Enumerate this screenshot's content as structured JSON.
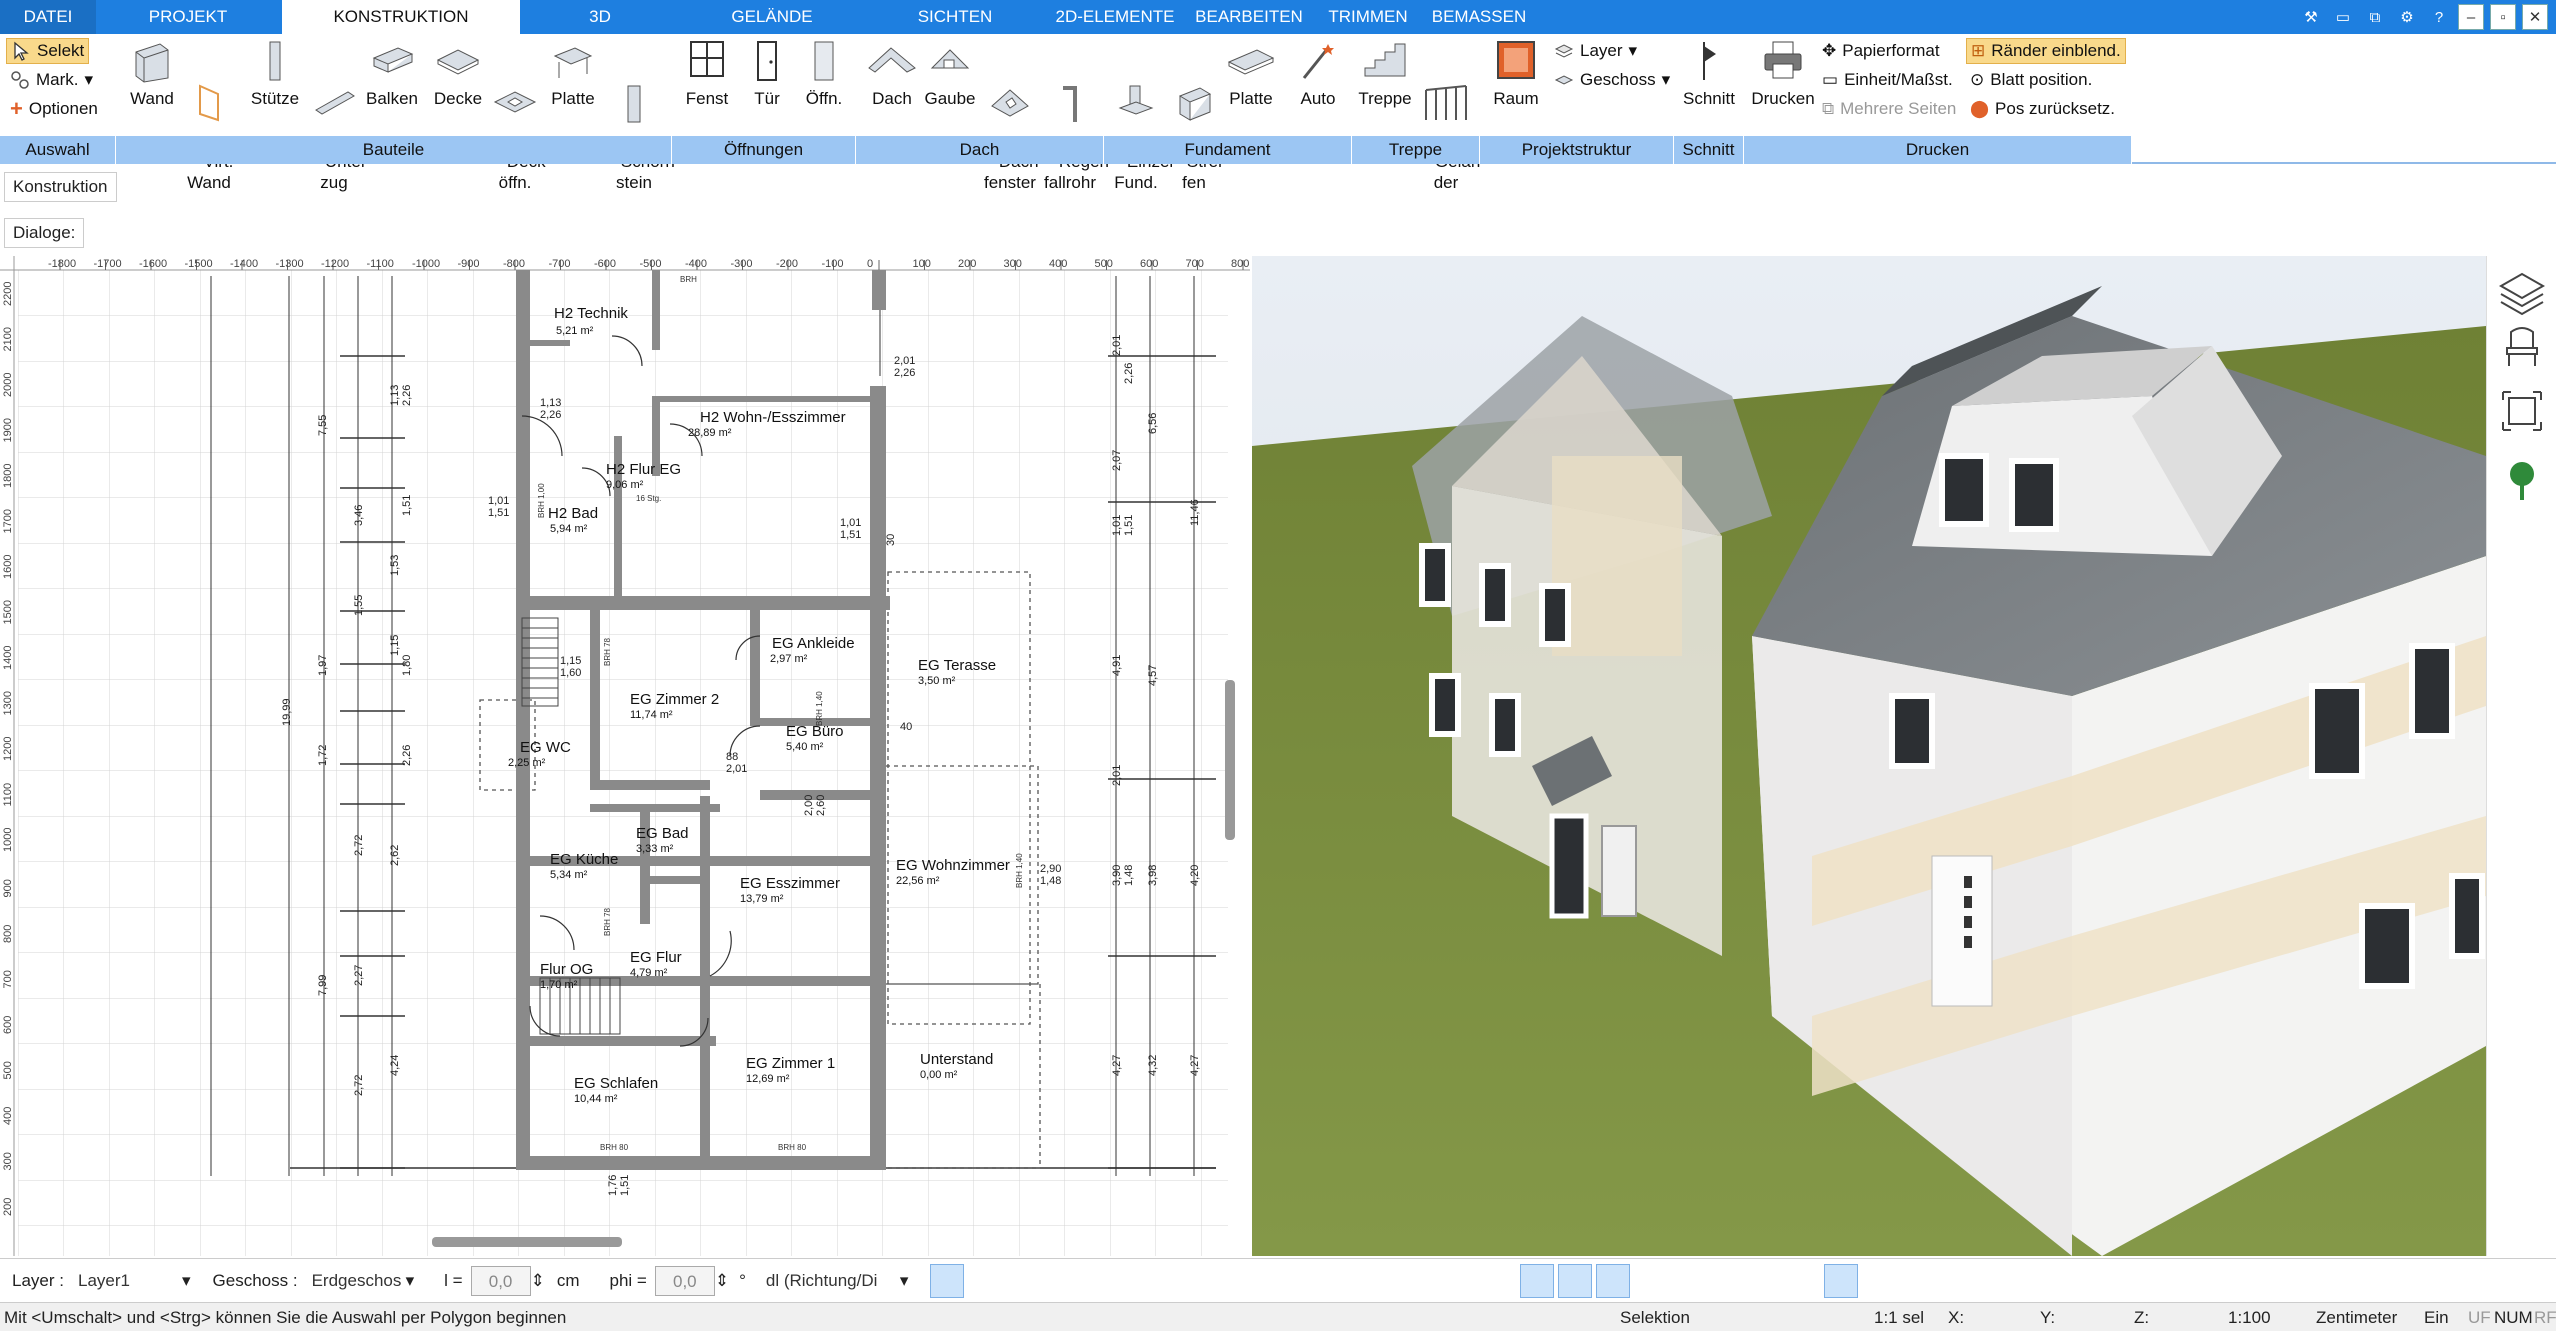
{
  "tabs": [
    "DATEI",
    "PROJEKT",
    "KONSTRUKTION",
    "3D",
    "GELÄNDE",
    "SICHTEN",
    "2D-ELEMENTE",
    "BEARBEITEN",
    "TRIMMEN",
    "BEMASSEN"
  ],
  "active_tab": "KONSTRUKTION",
  "ribbon": {
    "auswahl": {
      "selekt": "Selekt",
      "mark": "Mark.",
      "optionen": "Optionen"
    },
    "buttons": {
      "wand": "Wand",
      "virt_wand": "Virt.\nWand",
      "stuetze": "Stütze",
      "unterzug": "Unter-\nzug",
      "balken": "Balken",
      "decke": "Decke",
      "deckoeffn": "Deck-\nöffn.",
      "platte": "Platte",
      "schornstein": "Schorn-\nstein",
      "fenst": "Fenst",
      "tuer": "Tür",
      "oeffn": "Öffn.",
      "dach": "Dach",
      "gaube": "Gaube",
      "dachfenster": "Dach-\nfenster",
      "regenfallrohr": "Regen-\nfallrohr",
      "einzelfund": "Einzel\nFund.",
      "streifen": "Strei-\nfen",
      "fplatte": "Platte",
      "auto": "Auto",
      "treppe": "Treppe",
      "gelaender": "Gelän-\nder",
      "raum": "Raum",
      "schnitt": "Schnitt",
      "drucken": "Drucken"
    },
    "projektstruktur": {
      "layer": "Layer",
      "geschoss": "Geschoss"
    },
    "druck": {
      "papierformat": "Papierformat",
      "einheit": "Einheit/Maßst.",
      "mehrere": "Mehrere Seiten",
      "raender": "Ränder einblend.",
      "blatt": "Blatt position.",
      "pos": "Pos zurücksetz."
    },
    "groups": [
      "Auswahl",
      "Bauteile",
      "Öffnungen",
      "Dach",
      "Fundament",
      "Treppe",
      "Projektstruktur",
      "Schnitt",
      "Drucken"
    ]
  },
  "panel": {
    "konstruktion": "Konstruktion",
    "dialoge": "Dialoge:"
  },
  "ruler_top": [
    "-1800",
    "-1700",
    "-1600",
    "-1500",
    "-1400",
    "-1300",
    "-1200",
    "-1100",
    "-1000",
    "-900",
    "-800",
    "-700",
    "-600",
    "-500",
    "-400",
    "-300",
    "-200",
    "-100",
    "0",
    "100",
    "200",
    "300",
    "400",
    "500",
    "600",
    "700",
    "800"
  ],
  "ruler_left": [
    "2200",
    "2100",
    "2000",
    "1900",
    "1800",
    "1700",
    "1600",
    "1500",
    "1400",
    "1300",
    "1200",
    "1100",
    "1000",
    "900",
    "800",
    "700",
    "600",
    "500",
    "400",
    "300",
    "200"
  ],
  "rooms": [
    {
      "name": "H2 Technik",
      "area": "5,21 m²"
    },
    {
      "name": "H2 Wohn-/Esszimmer",
      "area": "28,89 m²"
    },
    {
      "name": "H2 Flur EG",
      "area": "9,06 m²"
    },
    {
      "name": "H2 Bad",
      "area": "5,94 m²"
    },
    {
      "name": "EG Ankleide",
      "area": "2,97 m²"
    },
    {
      "name": "EG Terasse",
      "area": "3,50 m²"
    },
    {
      "name": "EG Zimmer 2",
      "area": "11,74 m²"
    },
    {
      "name": "EG Büro",
      "area": "5,40 m²"
    },
    {
      "name": "EG WC",
      "area": "2,25 m²"
    },
    {
      "name": "EG Bad",
      "area": "3,33 m²"
    },
    {
      "name": "EG Küche",
      "area": "5,34 m²"
    },
    {
      "name": "EG Esszimmer",
      "area": "13,79 m²"
    },
    {
      "name": "EG Wohnzimmer",
      "area": "22,56 m²"
    },
    {
      "name": "EG Flur",
      "area": "4,79 m²"
    },
    {
      "name": "Flur OG",
      "area": "1,70 m²"
    },
    {
      "name": "EG Schlafen",
      "area": "10,44 m²"
    },
    {
      "name": "EG Zimmer 1",
      "area": "12,69 m²"
    },
    {
      "name": "Unterstand",
      "area": "0,00 m²"
    }
  ],
  "dims_left": [
    "7,55",
    "1,97",
    "1,72",
    "7,99",
    "2,72",
    "2,72",
    "2,62",
    "1,13",
    "2,26",
    "4,24",
    "1,15",
    "1,51",
    "1,53",
    "3,46",
    "1,55",
    "1,80",
    "2,26",
    "2,27",
    "19,99"
  ],
  "dims_right": [
    "2,01",
    "2,26",
    "6,56",
    "2,07",
    "1,01",
    "1,51",
    "4,91",
    "4,57",
    "11,46",
    "3,90",
    "1,48",
    "3,98",
    "4,20",
    "4,27",
    "4,32",
    "4,27",
    "2,01"
  ],
  "dims_inner": [
    "1,13",
    "2,26",
    "1,01",
    "1,51",
    "1,15",
    "1,60",
    "2,01",
    "2,26",
    "2,90",
    "1,48",
    "1,01",
    "1,51",
    "2,00",
    "2,60",
    "1,76",
    "1,51",
    "88",
    "2,01",
    "40",
    "30"
  ],
  "plan_labels": [
    "BRH 80",
    "BRH 80",
    "BRH 78",
    "BRH 78",
    "BRH 1,00",
    "BRH 1,40",
    "BRH 1,40",
    "BRH",
    "16 Stg."
  ],
  "options": {
    "layer_label": "Layer :",
    "layer_value": "Layer1",
    "geschoss_label": "Geschoss :",
    "geschoss_value": "Erdgeschos",
    "l_label": "l =",
    "l_value": "0,0",
    "l_unit": "cm",
    "phi_label": "phi =",
    "phi_value": "0,0",
    "phi_unit": "°",
    "dl_value": "dl (Richtung/Di"
  },
  "status": {
    "hint": "Mit <Umschalt> und <Strg> können Sie die Auswahl per Polygon beginnen",
    "mode": "Selektion",
    "sel": "1:1 sel",
    "x": "X:",
    "y": "Y:",
    "z": "Z:",
    "scale": "1:100",
    "unit": "Zentimeter",
    "ein": "Ein",
    "uf": "UF",
    "num": "NUM",
    "rf": "RF"
  },
  "icons": [
    "layers-icon",
    "chair-icon",
    "fit-view-icon",
    "tree-icon"
  ],
  "colors": {
    "accent": "#1e7fe0",
    "ribbon_group": "#9cc6f3",
    "grass": "#7c8f3f",
    "roof": "#7b8084"
  }
}
